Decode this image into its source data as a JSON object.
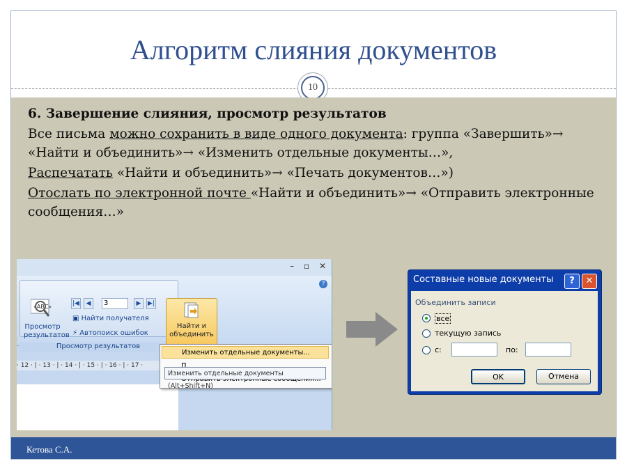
{
  "slide": {
    "title": "Алгоритм слияния документов",
    "page_number": "10",
    "footer_author": "Кетова С.А."
  },
  "body": {
    "heading": "6. Завершение слияния, просмотр результатов",
    "p1_a": "Все письма ",
    "p1_link": "можно сохранить в виде одного документа",
    "p1_b": ": группа «Завершить»→ «Найти и объединить»→ «Изменить отдельные документы…»,",
    "p2_link": "Распечатать",
    "p2_b": " «Найти и объединить»→ «Печать документов…»)",
    "p3_link": "Отослать по электронной почте ",
    "p3_b": " «Найти и объединить»→ «Отправить электронные сообщения…»"
  },
  "ribbon": {
    "preview_label_1": "Просмотр",
    "preview_label_2": "результатов",
    "record_value": "3",
    "find_recipient": "Найти получателя",
    "auto_check": "Автопоиск ошибок",
    "group_label": "Просмотр результатов",
    "finish_label_1": "Найти и",
    "finish_label_2": "объединить",
    "ruler_text": "· 12 · | · 13 · | · 14 · | · 15 · | · 16 · | · 17 ·",
    "menu_items": [
      "Изменить отдельные документы...",
      "П",
      "Отправить электронные сообщения..."
    ],
    "tooltip": "Изменить отдельные документы (Alt+Shift+N)"
  },
  "dialog": {
    "title": "Составные новые документы",
    "help": "?",
    "close": "✕",
    "group_label": "Объединить записи",
    "option_all": "все",
    "option_current": "текущую запись",
    "option_from": "с:",
    "to_label": "по:",
    "ok": "OK",
    "cancel": "Отмена"
  }
}
